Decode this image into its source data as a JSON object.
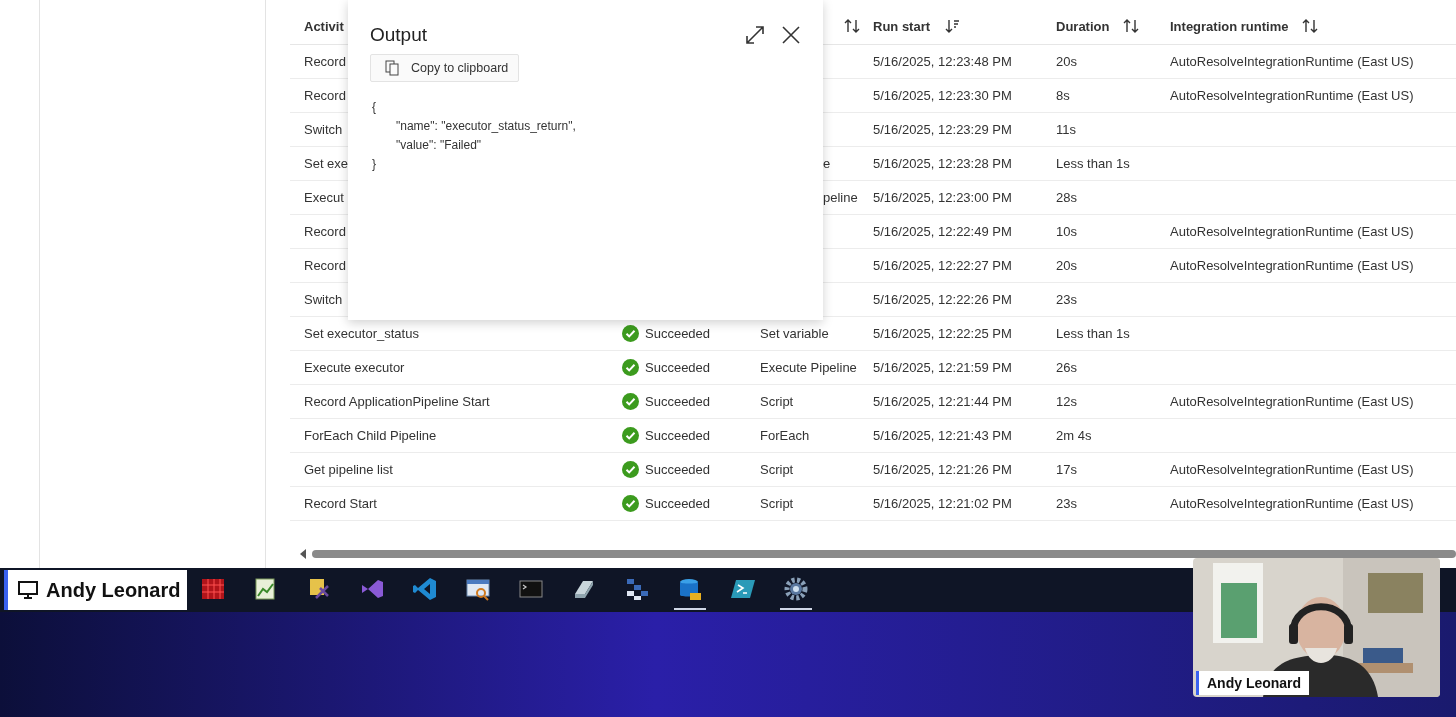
{
  "table": {
    "columns": [
      {
        "label": "Activit"
      },
      {},
      {
        "sorted": false
      },
      {
        "label": "Run start",
        "sorted": true
      },
      {
        "label": "Duration",
        "sorted": false
      },
      {
        "label": "Integration runtime",
        "sorted": false
      }
    ],
    "rows": [
      {
        "name": "Record",
        "run_start": "5/16/2025, 12:23:48 PM",
        "duration": "20s",
        "runtime": "AutoResolveIntegrationRuntime (East US)"
      },
      {
        "name": "Record",
        "run_start": "5/16/2025, 12:23:30 PM",
        "duration": "8s",
        "runtime": "AutoResolveIntegrationRuntime (East US)"
      },
      {
        "name": "Switch",
        "run_start": "5/16/2025, 12:23:29 PM",
        "duration": "11s"
      },
      {
        "name": "Set exe",
        "type": "e",
        "run_start": "5/16/2025, 12:23:28 PM",
        "duration": "Less than 1s"
      },
      {
        "name": "Execut",
        "type": "peline",
        "run_start": "5/16/2025, 12:23:00 PM",
        "duration": "28s"
      },
      {
        "name": "Record",
        "run_start": "5/16/2025, 12:22:49 PM",
        "duration": "10s",
        "runtime": "AutoResolveIntegrationRuntime (East US)"
      },
      {
        "name": "Record",
        "run_start": "5/16/2025, 12:22:27 PM",
        "duration": "20s",
        "runtime": "AutoResolveIntegrationRuntime (East US)"
      },
      {
        "name": "Switch",
        "run_start": "5/16/2025, 12:22:26 PM",
        "duration": "23s"
      },
      {
        "name": "Set executor_status",
        "status": "Succeeded",
        "type": "Set variable",
        "run_start": "5/16/2025, 12:22:25 PM",
        "duration": "Less than 1s"
      },
      {
        "name": "Execute executor",
        "status": "Succeeded",
        "type": "Execute Pipeline",
        "run_start": "5/16/2025, 12:21:59 PM",
        "duration": "26s"
      },
      {
        "name": "Record ApplicationPipeline Start",
        "status": "Succeeded",
        "type": "Script",
        "run_start": "5/16/2025, 12:21:44 PM",
        "duration": "12s",
        "runtime": "AutoResolveIntegrationRuntime (East US)"
      },
      {
        "name": "ForEach Child Pipeline",
        "status": "Succeeded",
        "type": "ForEach",
        "run_start": "5/16/2025, 12:21:43 PM",
        "duration": "2m 4s"
      },
      {
        "name": "Get pipeline list",
        "status": "Succeeded",
        "type": "Script",
        "run_start": "5/16/2025, 12:21:26 PM",
        "duration": "17s",
        "runtime": "AutoResolveIntegrationRuntime (East US)"
      },
      {
        "name": "Record Start",
        "status": "Succeeded",
        "type": "Script",
        "run_start": "5/16/2025, 12:21:02 PM",
        "duration": "23s",
        "runtime": "AutoResolveIntegrationRuntime (East US)"
      }
    ]
  },
  "output_panel": {
    "title": "Output",
    "copy_button": "Copy to clipboard",
    "lines": [
      {
        "kind": "brace",
        "text": "{"
      },
      {
        "kind": "entry",
        "text": "\"name\": \"executor_status_return\","
      },
      {
        "kind": "entry",
        "text": "\"value\": \"Failed\""
      },
      {
        "kind": "brace",
        "text": "}"
      }
    ]
  },
  "taskbar": {
    "presenter": "Andy Leonard",
    "apps": [
      {
        "kind": "grid",
        "active": false
      },
      {
        "kind": "chart",
        "active": false
      },
      {
        "kind": "tool",
        "active": false
      },
      {
        "kind": "vs",
        "active": false
      },
      {
        "kind": "code",
        "active": false
      },
      {
        "kind": "window",
        "active": false
      },
      {
        "kind": "terminal",
        "active": false
      },
      {
        "kind": "eraser",
        "active": false
      },
      {
        "kind": "blocks",
        "active": false
      },
      {
        "kind": "database",
        "active": true
      },
      {
        "kind": "shell",
        "active": false
      },
      {
        "kind": "gear",
        "active": true
      }
    ]
  },
  "webcam": {
    "kind": "picture",
    "name": "Andy Leonard"
  }
}
